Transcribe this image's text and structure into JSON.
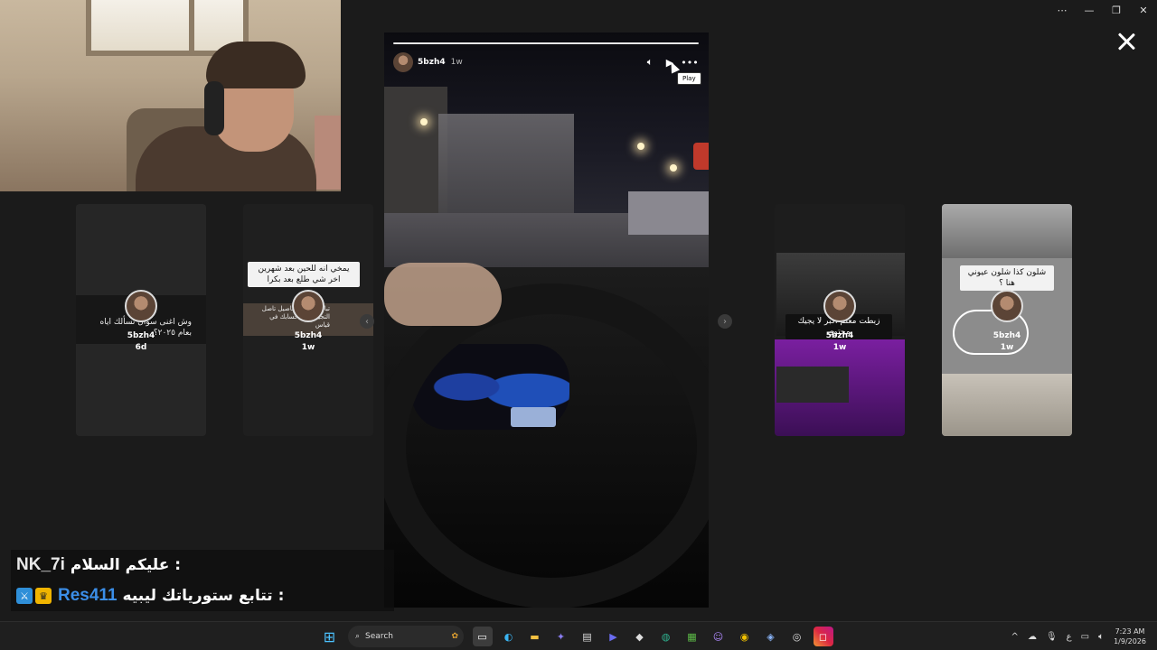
{
  "window": {
    "minimize_label": "⋯",
    "min": "—",
    "restore": "❐",
    "close": "✕"
  },
  "side_stories": [
    {
      "username": "5bzh4",
      "age": "6d",
      "caption": "وش اغنى سؤال تسألك اياه بعام ٢٠٢٥؟"
    },
    {
      "username": "5bzh4",
      "age": "1w",
      "caption_top": "يمخي انه للحين بعد شهرين اخر شي طلع بعد بكرا",
      "caption_small": "تبارك خالد للتفاصيل تاصل التجيل على حسابك في قياس"
    },
    {
      "username": "5bzh4",
      "age": "1w",
      "caption": "زبطت معلم اكبر لا يجيك محتوى"
    },
    {
      "username": "5bzh4",
      "age": "1w",
      "caption": "شلون كذا شلون عيوني هنا ؟"
    }
  ],
  "story": {
    "username": "5bzh4",
    "age": "1w",
    "tooltip": "Play",
    "progress": 1.0
  },
  "chat": [
    {
      "nick": "NK_7i",
      "text": "عليكم السلام :",
      "nick_color": "#e8e8e8"
    },
    {
      "nick": "Res411",
      "text": "تتابع ستورياتك ليبيه :",
      "nick_color": "#3b8ee8"
    }
  ],
  "taskbar": {
    "search_placeholder": "Search",
    "time": "7:23 AM",
    "date": "1/9/2026",
    "lang": "ع"
  }
}
